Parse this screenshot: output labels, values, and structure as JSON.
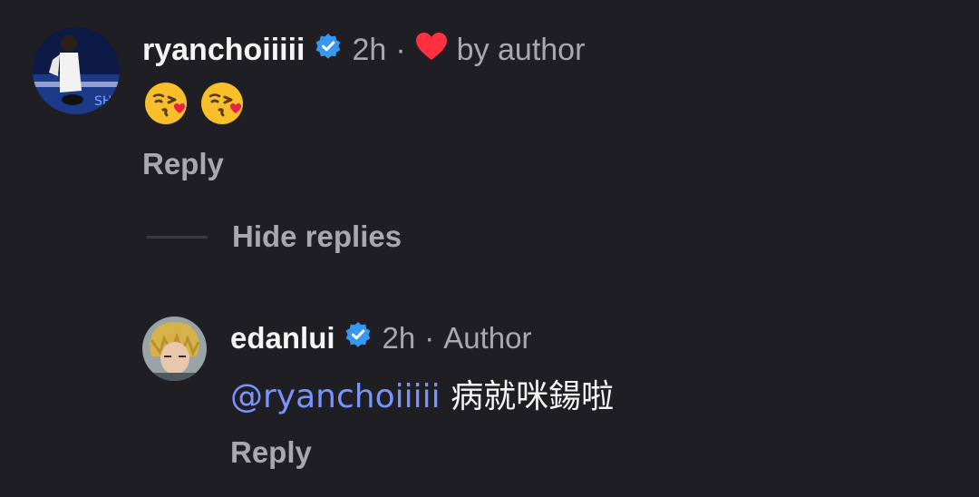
{
  "comment": {
    "username": "ryanchoiiiii",
    "time": "2h",
    "liked_by_author_label": "by author",
    "emojis": [
      "kissing-face-with-heart",
      "kissing-face-with-heart"
    ],
    "reply_label": "Reply"
  },
  "thread": {
    "hide_replies_label": "Hide replies"
  },
  "reply": {
    "username": "edanlui",
    "time": "2h",
    "author_badge": "Author",
    "mention": "@ryanchoiiiii",
    "text": "病就咪鍚啦",
    "reply_label": "Reply"
  },
  "colors": {
    "background": "#1f1f23",
    "verified": "#3897f0",
    "heart": "#ff3040",
    "mention": "#7b93ff",
    "muted": "#a8a8ad"
  }
}
